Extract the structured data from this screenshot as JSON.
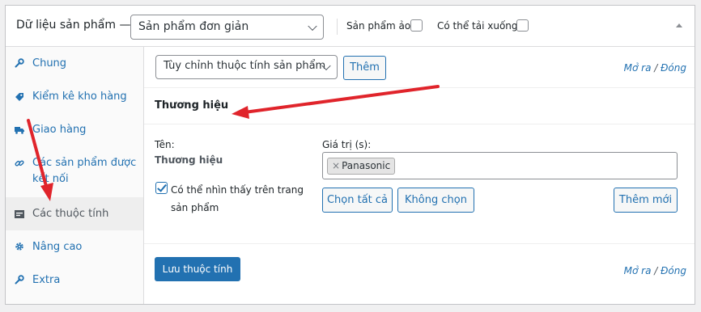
{
  "header": {
    "title": "Dữ liệu sản phẩm —",
    "product_type": "Sản phẩm đơn giản",
    "virtual_label": "Sản phẩm ảo:",
    "downloadable_label": "Có thể tải xuống:"
  },
  "sidebar": {
    "items": [
      {
        "label": "Chung",
        "icon": "wrench-icon"
      },
      {
        "label": "Kiểm kê kho hàng",
        "icon": "tag-icon"
      },
      {
        "label": "Giao hàng",
        "icon": "truck-icon"
      },
      {
        "label": "Các sản phẩm được kết nối",
        "icon": "link-icon"
      },
      {
        "label": "Các thuộc tính",
        "icon": "list-icon"
      },
      {
        "label": "Nâng cao",
        "icon": "gear-icon"
      },
      {
        "label": "Extra",
        "icon": "wrench-icon"
      }
    ],
    "active_index": 4
  },
  "toolbar": {
    "attribute_select": "Tùy chỉnh thuộc tính sản phẩm",
    "add_button": "Thêm",
    "expand": "Mở ra",
    "separator": "/",
    "close": "Đóng"
  },
  "attribute": {
    "heading": "Thương hiệu",
    "name_label": "Tên:",
    "name_value": "Thương hiệu",
    "values_label": "Giá trị (s):",
    "values": [
      "Panasonic"
    ],
    "chip_remove": "×",
    "visible_label": "Có thể nhìn thấy trên trang sản phẩm",
    "visible_checked": true,
    "select_all": "Chọn tất cả",
    "select_none": "Không chọn",
    "add_new": "Thêm mới"
  },
  "footer": {
    "save_button": "Lưu thuộc tính",
    "expand": "Mở ra",
    "separator": "/",
    "close": "Đóng"
  },
  "colors": {
    "accent": "#2271b1",
    "arrow": "#e0242b"
  }
}
